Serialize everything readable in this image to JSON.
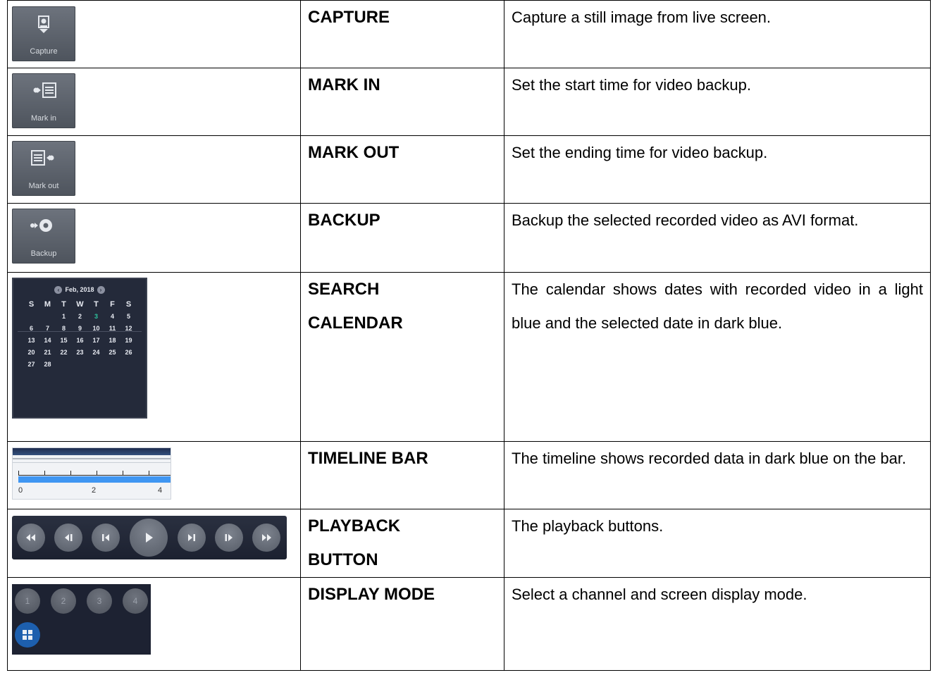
{
  "rows": [
    {
      "name": "CAPTURE",
      "desc": "Capture a still image from live screen.",
      "icon_name": "capture-icon",
      "icon_label": "Capture"
    },
    {
      "name": "MARK IN",
      "desc": "Set the start time for video backup.",
      "icon_name": "mark-in-icon",
      "icon_label": "Mark in"
    },
    {
      "name": "MARK OUT",
      "desc": "Set the ending time for video backup.",
      "icon_name": "mark-out-icon",
      "icon_label": "Mark out"
    },
    {
      "name": "BACKUP",
      "desc": "Backup the selected recorded video as AVI format.",
      "icon_name": "backup-icon",
      "icon_label": "Backup"
    },
    {
      "name": "SEARCH CALENDAR",
      "desc": "The calendar shows dates with recorded video in a light blue and the selected date in dark blue."
    },
    {
      "name": "TIMELINE BAR",
      "desc": "The timeline shows recorded data in dark blue on the bar."
    },
    {
      "name": "PLAYBACK BUTTON",
      "desc": "The playback buttons."
    },
    {
      "name": "DISPLAY MODE",
      "desc": "Select a channel and screen display mode."
    }
  ],
  "calendar": {
    "month": "Feb, 2018",
    "weekdays": [
      "S",
      "M",
      "T",
      "W",
      "T",
      "F",
      "S"
    ],
    "days": [
      "",
      "",
      "1",
      "2",
      "3",
      "4",
      "5",
      "6",
      "7",
      "8",
      "9",
      "10",
      "11",
      "12",
      "13",
      "14",
      "15",
      "16",
      "17",
      "18",
      "19",
      "20",
      "21",
      "22",
      "23",
      "24",
      "25",
      "26",
      "27",
      "28"
    ],
    "highlighted_day": "3",
    "highlight_color": "#2ec6a0"
  },
  "timeline": {
    "labels": [
      "0",
      "2",
      "4"
    ],
    "bar_color": "#3f96f2"
  },
  "playback_buttons": [
    "fast-rewind-icon",
    "step-back-icon",
    "prev-frame-icon",
    "play-icon",
    "next-frame-icon",
    "step-forward-icon",
    "fast-forward-icon"
  ],
  "display_mode": {
    "channels": [
      "1",
      "2",
      "3",
      "4"
    ],
    "selected_color": "#1d5fae"
  }
}
